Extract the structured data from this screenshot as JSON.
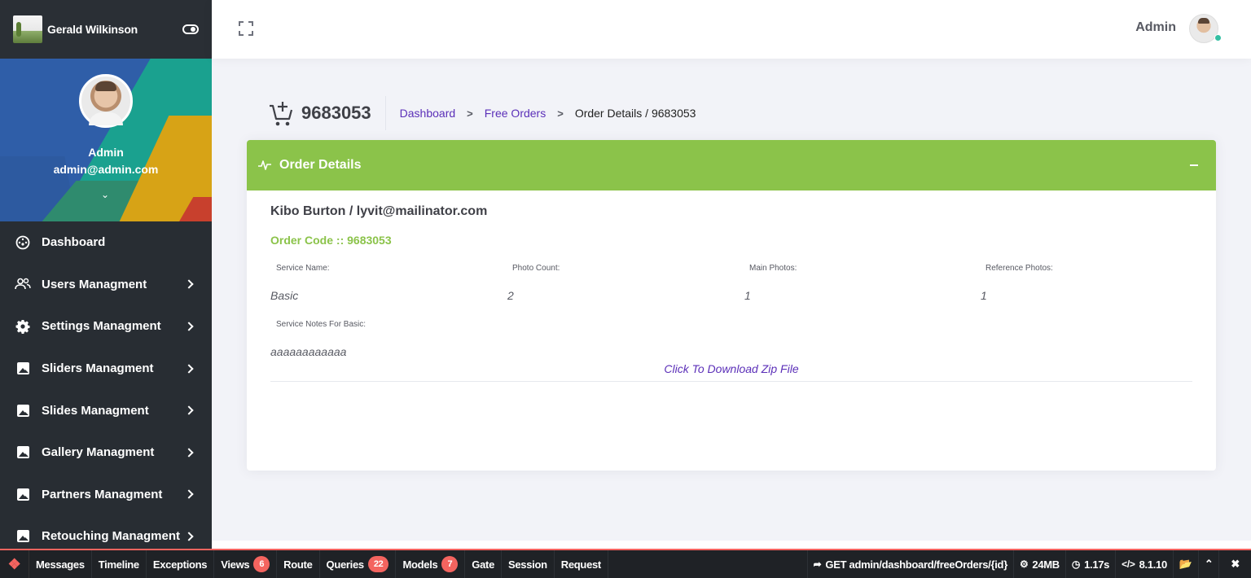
{
  "sidebar": {
    "brand": "Gerald Wilkinson",
    "user_name": "Admin",
    "user_email": "admin@admin.com",
    "items": [
      {
        "label": "Dashboard",
        "icon": "dashboard-icon",
        "has_arrow": false
      },
      {
        "label": "Users Managment",
        "icon": "users-icon",
        "has_arrow": true
      },
      {
        "label": "Settings Managment",
        "icon": "gear-icon",
        "has_arrow": true
      },
      {
        "label": "Sliders Managment",
        "icon": "image-icon",
        "has_arrow": true
      },
      {
        "label": "Slides Managment",
        "icon": "image-icon",
        "has_arrow": true
      },
      {
        "label": "Gallery Managment",
        "icon": "image-icon",
        "has_arrow": true
      },
      {
        "label": "Partners Managment",
        "icon": "image-icon",
        "has_arrow": true
      },
      {
        "label": "Retouching Managment",
        "icon": "image-icon",
        "has_arrow": true
      }
    ]
  },
  "topbar": {
    "user_label": "Admin"
  },
  "subheader": {
    "title": "9683053",
    "breadcrumbs": [
      {
        "label": "Dashboard",
        "link": true
      },
      {
        "label": "Free Orders",
        "link": true
      },
      {
        "label": "Order Details / 9683053",
        "link": false
      }
    ]
  },
  "portlet": {
    "title": "Order Details",
    "customer": "Kibo Burton / lyvit@mailinator.com",
    "order_code": "Order Code :: 9683053",
    "fields": [
      {
        "label": "Service Name:",
        "value": "Basic"
      },
      {
        "label": "Photo Count:",
        "value": "2"
      },
      {
        "label": "Main Photos:",
        "value": "1"
      },
      {
        "label": "Reference Photos:",
        "value": "1"
      }
    ],
    "notes_label": "Service Notes For Basic:",
    "notes_value": "aaaaaaaaaaaa",
    "download_link": "Click To Download Zip File"
  },
  "debugbar": {
    "tabs": [
      {
        "label": "Messages",
        "badge": ""
      },
      {
        "label": "Timeline",
        "badge": ""
      },
      {
        "label": "Exceptions",
        "badge": ""
      },
      {
        "label": "Views",
        "badge": "6"
      },
      {
        "label": "Route",
        "badge": ""
      },
      {
        "label": "Queries",
        "badge": "22"
      },
      {
        "label": "Models",
        "badge": "7"
      },
      {
        "label": "Gate",
        "badge": ""
      },
      {
        "label": "Session",
        "badge": ""
      },
      {
        "label": "Request",
        "badge": ""
      }
    ],
    "request": "GET admin/dashboard/freeOrders/{id}",
    "memory": "24MB",
    "time": "1.17s",
    "php_version": "8.1.10"
  },
  "colors": {
    "accent_green": "#8bc34a",
    "link_purple": "#5b2fb8",
    "debug_red": "#f4645f",
    "sidebar_bg": "#282d33"
  }
}
